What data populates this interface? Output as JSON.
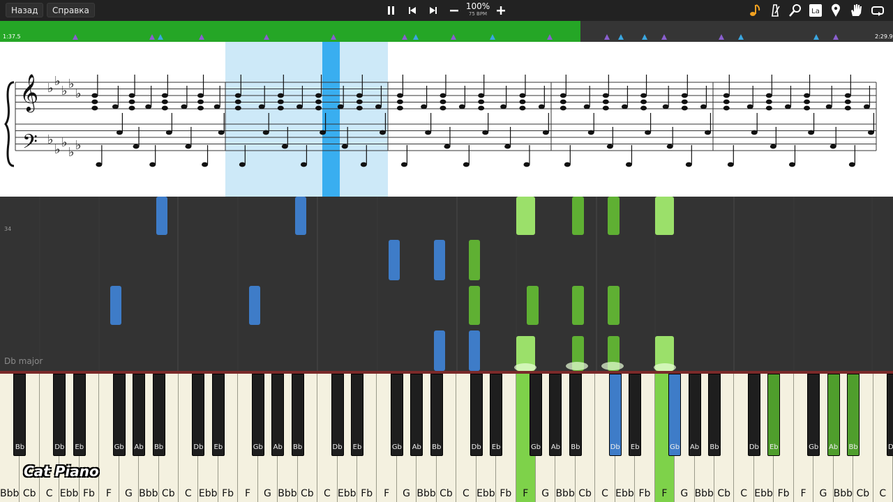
{
  "toolbar": {
    "back_label": "Назад",
    "help_label": "Справка",
    "speed_percent": "100%",
    "bpm_label": "75 BPM",
    "right_icons": [
      "note-icon",
      "metronome-icon",
      "magnifier-icon",
      "la-icon",
      "location-pin-icon",
      "hand-icon",
      "loop-icon"
    ],
    "la_text": "La"
  },
  "timeline": {
    "current_time": "1:37.5",
    "total_time": "2:29.9",
    "progress": 0.65,
    "played_color": "#25a626"
  },
  "roll": {
    "key_signature_label": "Db major",
    "measure_number": "34",
    "left_hand_color": "#3e7cc8",
    "right_hand_color": "#5fb033"
  },
  "keyboard": {
    "white_keys": [
      "Bbb",
      "Cb",
      "C",
      "Ebb",
      "Fb",
      "F",
      "G",
      "Bbb",
      "Cb",
      "C",
      "Ebb",
      "Fb",
      "F",
      "G",
      "Bbb",
      "Cb",
      "C",
      "Ebb",
      "Fb",
      "F",
      "G",
      "Bbb",
      "Cb",
      "C",
      "Ebb",
      "Fb",
      "F",
      "G",
      "Bbb",
      "Cb",
      "C",
      "Ebb",
      "Fb",
      "F",
      "G",
      "Bbb",
      "Cb",
      "C",
      "Ebb",
      "Fb",
      "F",
      "G",
      "Bbb",
      "Cb",
      "C"
    ],
    "black_keys": [
      "Bb",
      "Db",
      "Eb",
      "Gb",
      "Ab",
      "Bb",
      "Db",
      "Eb",
      "Gb",
      "Ab",
      "Bb",
      "Db",
      "Eb",
      "Gb",
      "Ab",
      "Bb",
      "Db",
      "Eb",
      "Gb",
      "Ab",
      "Bb",
      "Db",
      "Eb",
      "Gb",
      "Ab",
      "Bb",
      "Db",
      "Eb",
      "Gb",
      "Ab",
      "Bb",
      "Db"
    ]
  },
  "logo_text": "Cat Piano"
}
